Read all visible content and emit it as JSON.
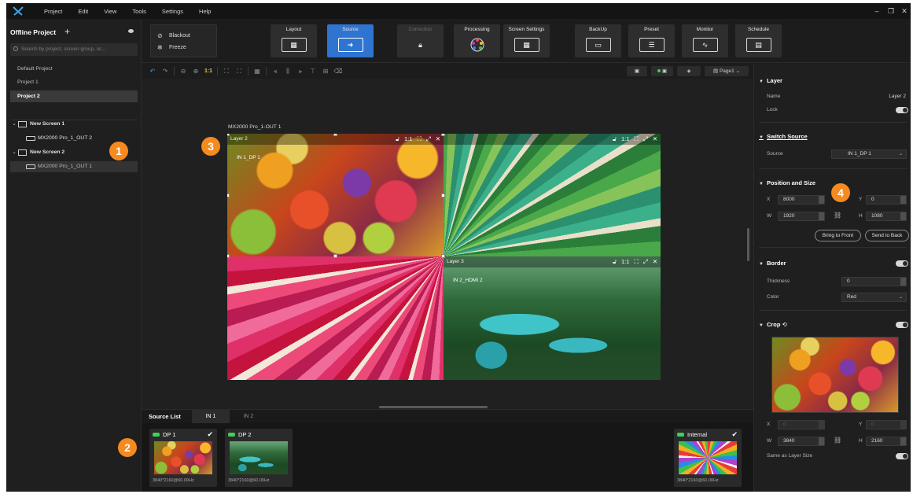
{
  "menu": [
    "Project",
    "Edit",
    "View",
    "Tools",
    "Settings",
    "Help"
  ],
  "window_controls": [
    "–",
    "❐",
    "✕"
  ],
  "left_panel": {
    "title": "Offline Project",
    "search_placeholder": "Search by project, screen group, sc...",
    "projects": [
      "Default Project",
      "Project 1",
      "Project 2"
    ],
    "selected_project": "Project 2",
    "tree": [
      {
        "label": "New Screen 1",
        "level": 0
      },
      {
        "label": "MX2000 Pro_1_OUT 2",
        "level": 1
      },
      {
        "label": "New Screen 2",
        "level": 0
      },
      {
        "label": "MX2000 Pro_1_OUT 1",
        "level": 1
      }
    ]
  },
  "badges": [
    "1",
    "2",
    "3",
    "4"
  ],
  "toolbar": {
    "blackout": "Blackout",
    "freeze": "Freeze",
    "buttons": [
      {
        "label": "Layout",
        "icon": "layout-grid-icon",
        "state": "normal"
      },
      {
        "label": "Source",
        "icon": "source-arrow-icon",
        "state": "active"
      },
      {
        "label": "Correction",
        "icon": "lock-icon",
        "state": "disabled"
      },
      {
        "label": "Processing",
        "icon": "color-wheel-icon",
        "state": "normal"
      },
      {
        "label": "Screen Settings",
        "icon": "screen-settings-icon",
        "state": "normal"
      },
      {
        "label": "BackUp",
        "icon": "backup-icon",
        "state": "normal"
      },
      {
        "label": "Preset",
        "icon": "preset-icon",
        "state": "normal"
      },
      {
        "label": "Monitor",
        "icon": "monitor-wave-icon",
        "state": "normal"
      },
      {
        "label": "Schedule",
        "icon": "schedule-icon",
        "state": "normal"
      }
    ]
  },
  "canvas_toolbar": {
    "zoom_label": "1:1",
    "page_label": "Page1"
  },
  "canvas": {
    "output_label": "MX2000 Pro_1-OUT 1",
    "layers": [
      {
        "name": "Layer 2",
        "source": "IN 1_DP 1",
        "zoom": "1:1"
      },
      {
        "name": "",
        "source": "",
        "zoom": "1:1"
      },
      {
        "name": "Layer 3",
        "source": "IN 2_HDMI 2",
        "zoom": "1:1"
      }
    ]
  },
  "right_panel": {
    "layer_title": "Layer",
    "name_label": "Name",
    "name_value": "Layer 2",
    "lock_label": "Lock",
    "switch_title": "Switch Source",
    "source_label": "Source",
    "source_value": "IN 1_DP 1",
    "pos_title": "Position and Size",
    "x_label": "X",
    "x_value": "8000",
    "y_label": "Y",
    "y_value": "0",
    "w_label": "W",
    "w_value": "1920",
    "h_label": "H",
    "h_value": "1080",
    "bring_front": "Bring to Front",
    "send_back": "Send to Back",
    "border_title": "Border",
    "thickness_label": "Thickness",
    "thickness_value": "0",
    "color_label": "Color",
    "color_value": "Red",
    "crop_title": "Crop",
    "crop_x_label": "X",
    "crop_x_value": "0",
    "crop_y_label": "Y",
    "crop_y_value": "0",
    "crop_w_label": "W",
    "crop_w_value": "3840",
    "crop_h_label": "H",
    "crop_h_value": "2160",
    "same_size_label": "Same as Layer Size"
  },
  "source_list": {
    "title": "Source List",
    "tabs": [
      "IN 1",
      "IN 2"
    ],
    "active_tab": "IN 1",
    "cards": [
      {
        "name": "DP 1",
        "res": "3840*2160@60.00Hz",
        "checked": true,
        "image": "fruit"
      },
      {
        "name": "DP 2",
        "res": "3840*2160@60.00Hz",
        "checked": false,
        "image": "river"
      },
      {
        "name": "Internal",
        "res": "3840*2160@60.00Hz",
        "checked": true,
        "image": "burst"
      }
    ]
  },
  "colors": {
    "accent": "#2f74d0",
    "badge": "#f58a1f",
    "status_green": "#3fcf5a",
    "background": "#1c1c1c"
  }
}
